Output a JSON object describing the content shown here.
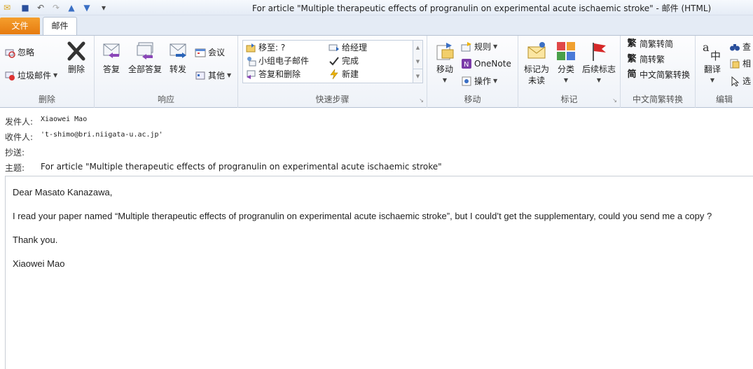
{
  "window": {
    "title": "For article \"Multiple therapeutic effects of progranulin on experimental acute ischaemic stroke\"  -  邮件 (HTML)"
  },
  "tabs": {
    "file": "文件",
    "mail": "邮件"
  },
  "ribbon": {
    "delete": {
      "ignore": "忽略",
      "junk": "垃圾邮件",
      "delete": "删除",
      "label": "删除"
    },
    "respond": {
      "reply": "答复",
      "reply_all": "全部答复",
      "forward": "转发",
      "meeting": "会议",
      "more": "其他",
      "label": "响应"
    },
    "quicksteps": {
      "move_to": "移至: ?",
      "to_manager": "给经理",
      "team_email": "小组电子邮件",
      "done": "完成",
      "reply_delete": "答复和删除",
      "create_new": "新建",
      "label": "快速步骤"
    },
    "move": {
      "move": "移动",
      "rules": "规则",
      "onenote": "OneNote",
      "actions": "操作",
      "label": "移动"
    },
    "tags": {
      "mark_unread_1": "标记为",
      "mark_unread_2": "未读",
      "categorize": "分类",
      "follow_up": "后续标志",
      "label": "标记"
    },
    "chinese": {
      "trad": "简繁转简",
      "simp": "简转繁",
      "convert": "中文简繁转换",
      "label": "中文简繁转换"
    },
    "editing": {
      "translate": "翻译",
      "find": "查",
      "related": "相",
      "select": "选",
      "label": "编辑"
    }
  },
  "headers": {
    "from_label": "发件人:",
    "from": "Xiaowei Mao",
    "to_label": "收件人:",
    "to": "'t-shimo@bri.niigata-u.ac.jp'",
    "cc_label": "抄送:",
    "subject_label": "主题:",
    "subject": "For article \"Multiple therapeutic effects of progranulin on experimental acute ischaemic stroke\""
  },
  "message": {
    "greeting": "Dear Masato Kanazawa,",
    "paragraph": "I read your paper named “Multiple therapeutic effects of progranulin on experimental acute ischaemic stroke”, but I could’t get the supplementary, could you send me a copy ?",
    "thanks": "Thank you.",
    "signature": "Xiaowei Mao"
  },
  "colors": {
    "file_tab": "#e67b10",
    "ribbon_bg": "#eef2f8",
    "accent": "#2a64b8"
  }
}
